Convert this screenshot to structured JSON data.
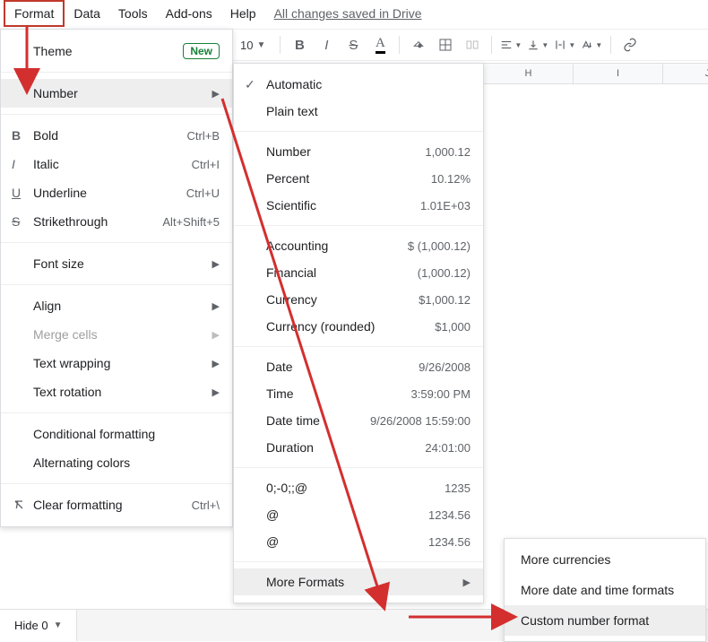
{
  "menubar": {
    "format": "Format",
    "data": "Data",
    "tools": "Tools",
    "addons": "Add-ons",
    "help": "Help",
    "drive_status": "All changes saved in Drive"
  },
  "toolbar": {
    "font_size": "10"
  },
  "columns": [
    "H",
    "I",
    "J"
  ],
  "format_menu": {
    "theme": "Theme",
    "theme_badge": "New",
    "number": "Number",
    "bold": "Bold",
    "bold_sc": "Ctrl+B",
    "italic": "Italic",
    "italic_sc": "Ctrl+I",
    "underline": "Underline",
    "underline_sc": "Ctrl+U",
    "strike": "Strikethrough",
    "strike_sc": "Alt+Shift+5",
    "font_size": "Font size",
    "align": "Align",
    "merge": "Merge cells",
    "wrap": "Text wrapping",
    "rotation": "Text rotation",
    "cond": "Conditional formatting",
    "alt": "Alternating colors",
    "clear": "Clear formatting",
    "clear_sc": "Ctrl+\\"
  },
  "number_menu": [
    {
      "label": "Automatic",
      "check": true
    },
    {
      "label": "Plain text"
    },
    {
      "sep": true
    },
    {
      "label": "Number",
      "example": "1,000.12"
    },
    {
      "label": "Percent",
      "example": "10.12%"
    },
    {
      "label": "Scientific",
      "example": "1.01E+03"
    },
    {
      "sep": true
    },
    {
      "label": "Accounting",
      "example": "$ (1,000.12)"
    },
    {
      "label": "Financial",
      "example": "(1,000.12)"
    },
    {
      "label": "Currency",
      "example": "$1,000.12"
    },
    {
      "label": "Currency (rounded)",
      "example": "$1,000"
    },
    {
      "sep": true
    },
    {
      "label": "Date",
      "example": "9/26/2008"
    },
    {
      "label": "Time",
      "example": "3:59:00 PM"
    },
    {
      "label": "Date time",
      "example": "9/26/2008 15:59:00"
    },
    {
      "label": "Duration",
      "example": "24:01:00"
    },
    {
      "sep": true
    },
    {
      "label": "0;-0;;@",
      "example": "1235"
    },
    {
      "label": "@",
      "example": "1234.56"
    },
    {
      "label": "@",
      "example": "1234.56"
    },
    {
      "sep": true
    },
    {
      "label": "More Formats",
      "arrow": true,
      "highlighted": true
    }
  ],
  "more_menu": {
    "currencies": "More currencies",
    "datetime": "More date and time formats",
    "custom": "Custom number format"
  },
  "sheet_tab": "Hide 0"
}
